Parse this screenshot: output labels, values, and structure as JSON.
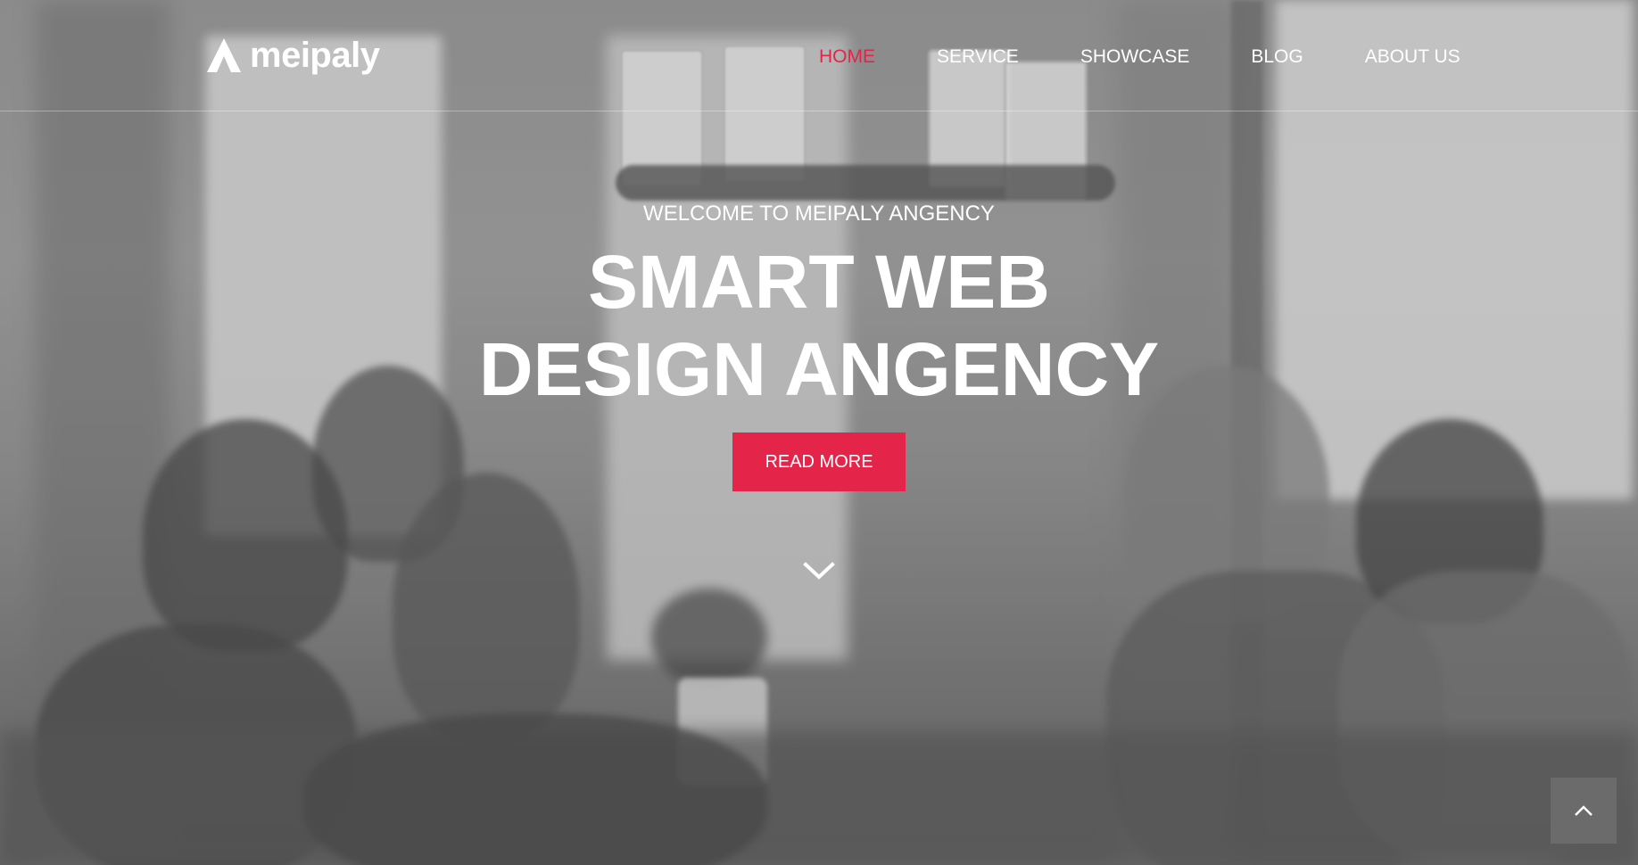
{
  "brand": {
    "name": "meipaly",
    "logo_icon": "triangle-a-logo"
  },
  "nav": {
    "items": [
      {
        "label": "HOME",
        "active": true
      },
      {
        "label": "SERVICE",
        "active": false
      },
      {
        "label": "SHOWCASE",
        "active": false
      },
      {
        "label": "BLOG",
        "active": false
      },
      {
        "label": "ABOUT US",
        "active": false
      }
    ]
  },
  "hero": {
    "subtitle": "WELCOME TO MEIPALY ANGENCY",
    "title_line1": "SMART WEB",
    "title_line2": "DESIGN ANGENCY",
    "cta_label": "READ MORE",
    "scroll_icon": "chevron-down-icon"
  },
  "back_to_top": {
    "icon": "chevron-up-icon"
  },
  "colors": {
    "accent": "#e5244a",
    "text": "#ffffff",
    "back_to_top_bg": "#6e6e6e"
  }
}
